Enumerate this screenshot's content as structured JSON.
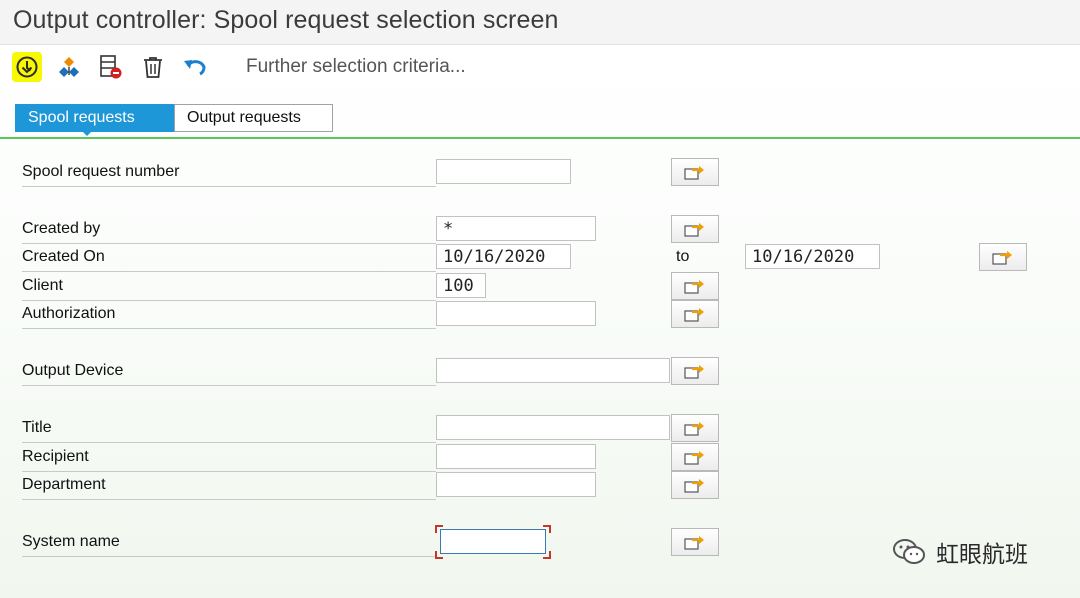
{
  "window": {
    "title": "Output controller: Spool request selection screen"
  },
  "toolbar": {
    "items": [
      {
        "icon": "execute-icon"
      },
      {
        "icon": "get-variant-icon"
      },
      {
        "icon": "delete-selection-icon"
      },
      {
        "icon": "trash-icon"
      },
      {
        "icon": "undo-icon"
      }
    ],
    "further_criteria": "Further selection criteria..."
  },
  "tabs": [
    {
      "label": "Spool requests",
      "active": true
    },
    {
      "label": "Output requests",
      "active": false
    }
  ],
  "form": {
    "spool_request_number": {
      "label": "Spool request number",
      "value": ""
    },
    "created_by": {
      "label": "Created by",
      "value": "*"
    },
    "created_on": {
      "label": "Created On",
      "from": "10/16/2020",
      "to_label": "to",
      "to": "10/16/2020"
    },
    "client": {
      "label": "Client",
      "value": "100"
    },
    "authorization": {
      "label": "Authorization",
      "value": ""
    },
    "output_device": {
      "label": "Output Device",
      "value": ""
    },
    "title": {
      "label": "Title",
      "value": ""
    },
    "recipient": {
      "label": "Recipient",
      "value": ""
    },
    "department": {
      "label": "Department",
      "value": ""
    },
    "system_name": {
      "label": "System name",
      "value": ""
    }
  },
  "watermark": {
    "text": "虹眼航班",
    "icon": "wechat-icon"
  },
  "colors": {
    "tab_active": "#1d97d7",
    "separator": "#5bc85b",
    "execute_highlight": "#f8f800",
    "focus_corner": "#c0392b"
  }
}
